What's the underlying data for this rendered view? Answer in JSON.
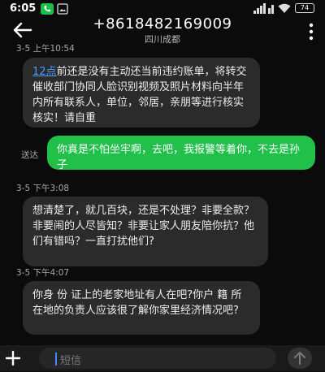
{
  "status": {
    "time": "6:05",
    "battery": "74"
  },
  "header": {
    "phone_number": "+8618482169009",
    "location": "四川成都"
  },
  "messages": [
    {
      "timestamp": "3-5 上午10:54",
      "link": "12点",
      "text": "前还是没有主动还当前违约账单，将转交催收部门协同人脸识别视频及照片材料向半年内所有联系人，单位，邻居，亲朋等进行核实核实！请自重"
    },
    {
      "text": "你真是不怕坐牢啊，去吧，我报警等着你，不去是孙子",
      "status": "送达"
    },
    {
      "timestamp": "3-5 下午3:08",
      "text": "想清楚了，就几百块，还是不处理？非要全款？非要闹的人尽皆知？非要让家人朋友陪你抗？他们有错吗？一直打扰他们?"
    },
    {
      "timestamp": "3-5 下午4:07",
      "text": "你身 份 证上的老家地址有人在吧?你户 籍 所在地的负责人应该很了解你家里经济情况吧?"
    }
  ],
  "input": {
    "placeholder": "短信"
  },
  "colors": {
    "outgoing": "#20c04a",
    "incoming": "#2b2b2b",
    "link": "#4a9bff",
    "background": "#0b0b0b"
  }
}
